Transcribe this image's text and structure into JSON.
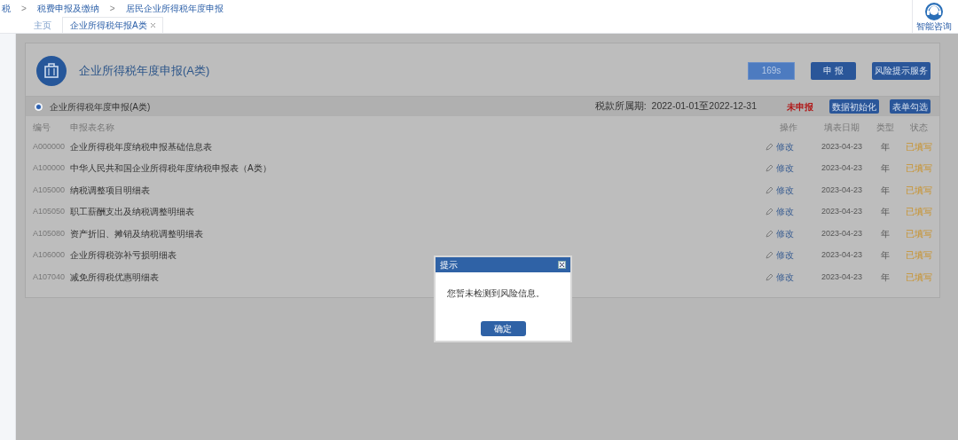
{
  "breadcrumb": [
    "税",
    "税费申报及缴纳",
    "居民企业所得税年度申报"
  ],
  "breadcrumb_separator": ">",
  "tabs": [
    {
      "label": "主页",
      "selected": false,
      "closable": false
    },
    {
      "label": "企业所得税年报A类",
      "selected": true,
      "closable": true
    }
  ],
  "help": {
    "label": "智能咨询"
  },
  "panel": {
    "title": "企业所得税年度申报(A类)",
    "buttons": [
      {
        "label": "169s",
        "kind": "timer"
      },
      {
        "label": "申 报",
        "kind": "primary"
      },
      {
        "label": "风险提示服务",
        "kind": "primary"
      }
    ]
  },
  "form_bar": {
    "label": "企业所得税年度申报(A类)",
    "selected": true,
    "period": "税款所属期:  2022-01-01至2022-12-31",
    "status": "未申报",
    "buttons": [
      "数据初始化",
      "表单勾选"
    ]
  },
  "table": {
    "columns": [
      "编号",
      "申报表名称",
      "操作",
      "填表日期",
      "类型",
      "状态"
    ],
    "rows": [
      {
        "code": "A000000",
        "name": "企业所得税年度纳税申报基础信息表",
        "action": "修改",
        "date": "2023-04-23",
        "type": "年",
        "status": "已填写"
      },
      {
        "code": "A100000",
        "name": "中华人民共和国企业所得税年度纳税申报表（A类）",
        "action": "修改",
        "date": "2023-04-23",
        "type": "年",
        "status": "已填写"
      },
      {
        "code": "A105000",
        "name": "纳税调整项目明细表",
        "action": "修改",
        "date": "2023-04-23",
        "type": "年",
        "status": "已填写"
      },
      {
        "code": "A105050",
        "name": "职工薪酬支出及纳税调整明细表",
        "action": "修改",
        "date": "2023-04-23",
        "type": "年",
        "status": "已填写"
      },
      {
        "code": "A105080",
        "name": "资产折旧、摊销及纳税调整明细表",
        "action": "修改",
        "date": "2023-04-23",
        "type": "年",
        "status": "已填写"
      },
      {
        "code": "A106000",
        "name": "企业所得税弥补亏损明细表",
        "action": "修改",
        "date": "2023-04-23",
        "type": "年",
        "status": "已填写"
      },
      {
        "code": "A107040",
        "name": "减免所得税优惠明细表",
        "action": "修改",
        "date": "2023-04-23",
        "type": "年",
        "status": "已填写"
      }
    ]
  },
  "dialog": {
    "title": "提示",
    "message": "您暂未检测到风险信息。",
    "button": "确定"
  }
}
